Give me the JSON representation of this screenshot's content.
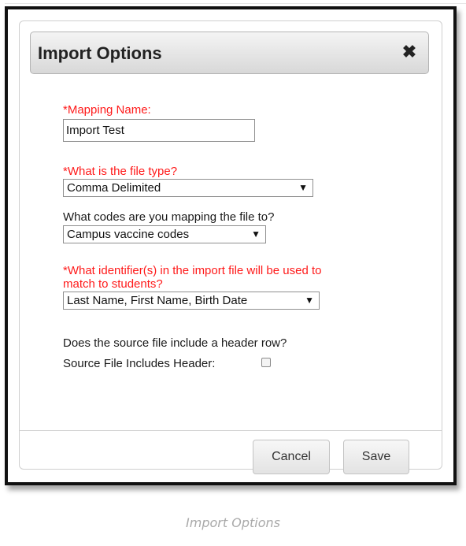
{
  "dialog": {
    "title": "Import Options",
    "close_icon": "close-icon",
    "mapping_name": {
      "label": "*Mapping Name:",
      "value": "Import Test"
    },
    "file_type": {
      "label": "*What is the file type?",
      "selected": "Comma Delimited"
    },
    "codes": {
      "label": "What codes are you mapping the file to?",
      "selected": "Campus vaccine codes"
    },
    "identifiers": {
      "label_line1": "*What identifier(s) in the import file will be used to",
      "label_line2": "match to students?",
      "selected": "Last Name, First Name, Birth Date"
    },
    "header_row": {
      "question": "Does the source file include a header row?",
      "checkbox_label": "Source File Includes Header:",
      "checked": false
    },
    "buttons": {
      "cancel": "Cancel",
      "save": "Save"
    }
  },
  "caption": "Import Options",
  "colors": {
    "required_label": "#ff1a1a",
    "caption": "#a9a9a9",
    "frame_border": "#111111"
  }
}
